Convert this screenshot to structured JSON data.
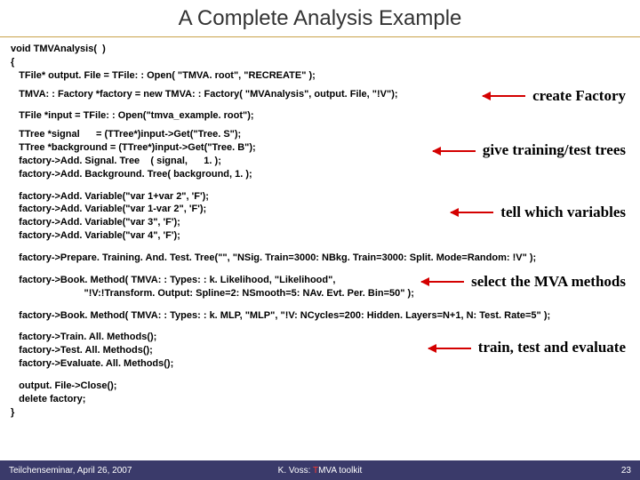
{
  "title": "A Complete Analysis Example",
  "code": {
    "l1": "void TMVAnalysis(  )",
    "l2": "{",
    "l3": "   TFile* output. File = TFile: : Open( \"TMVA. root\", \"RECREATE\" );",
    "l4": "   TMVA: : Factory *factory = new TMVA: : Factory( \"MVAnalysis\", output. File, \"!V\");",
    "l5": "   TFile *input = TFile: : Open(\"tmva_example. root\");",
    "l6": "   TTree *signal      = (TTree*)input->Get(\"Tree. S\");",
    "l7": "   TTree *background = (TTree*)input->Get(\"Tree. B\");",
    "l8": "   factory->Add. Signal. Tree    ( signal,      1. );",
    "l9": "   factory->Add. Background. Tree( background, 1. );",
    "l10": "   factory->Add. Variable(\"var 1+var 2\", 'F');",
    "l11": "   factory->Add. Variable(\"var 1-var 2\", 'F');",
    "l12": "   factory->Add. Variable(\"var 3\", 'F');",
    "l13": "   factory->Add. Variable(\"var 4\", 'F');",
    "l14": "   factory->Prepare. Training. And. Test. Tree(\"\", \"NSig. Train=3000: NBkg. Train=3000: Split. Mode=Random: !V\" );",
    "l15": "   factory->Book. Method( TMVA: : Types: : k. Likelihood, \"Likelihood\",",
    "l16": "                           \"!V:!Transform. Output: Spline=2: NSmooth=5: NAv. Evt. Per. Bin=50\" );",
    "l17": "   factory->Book. Method( TMVA: : Types: : k. MLP, \"MLP\", \"!V: NCycles=200: Hidden. Layers=N+1, N: Test. Rate=5\" );",
    "l18": "   factory->Train. All. Methods();",
    "l19": "   factory->Test. All. Methods();",
    "l20": "   factory->Evaluate. All. Methods();",
    "l21": "   output. File->Close();",
    "l22": "   delete factory;",
    "l23": "}"
  },
  "annotations": {
    "a1": "create Factory",
    "a2": "give training/test trees",
    "a3": "tell which variables",
    "a4": "select the MVA methods",
    "a5": "train, test and evaluate"
  },
  "footer": {
    "left": "Teilchenseminar, April 26, 2007",
    "center_prefix": "K. Voss: ",
    "center_red": "T",
    "center_suffix": "MVA toolkit",
    "right": "23"
  }
}
